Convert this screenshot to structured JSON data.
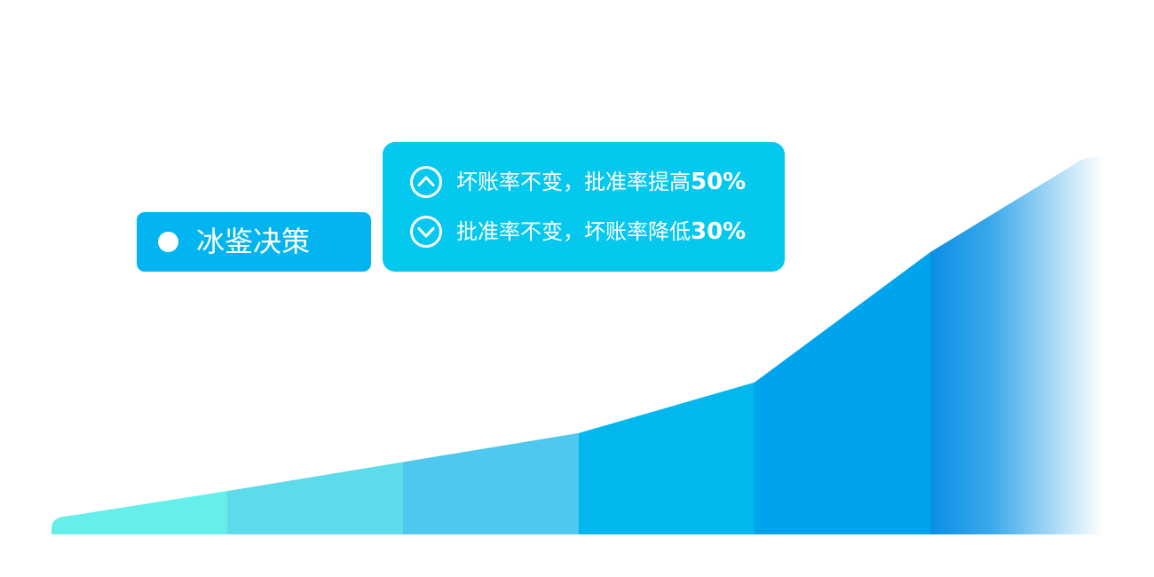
{
  "chart_data": {
    "type": "area",
    "x": [
      1,
      2,
      3,
      4,
      5,
      6
    ],
    "values": [
      1,
      2,
      3,
      4,
      6.5,
      13
    ],
    "colors": [
      "#66efea",
      "#5ddbeb",
      "#4ec8ee",
      "#02b7ed",
      "#00a4ec",
      "#0a8ee6"
    ],
    "fade_to": "#ffffff"
  },
  "tag": {
    "label": "冰鉴决策",
    "color": "#02b4f0"
  },
  "callout": {
    "color": "#05c8ee",
    "rows": [
      {
        "icon": "chevron-up-circle-icon",
        "text": "坏账率不变，批准率提高",
        "value": "50%"
      },
      {
        "icon": "chevron-down-circle-icon",
        "text": "批准率不变，坏账率降低",
        "value": "30%"
      }
    ]
  }
}
